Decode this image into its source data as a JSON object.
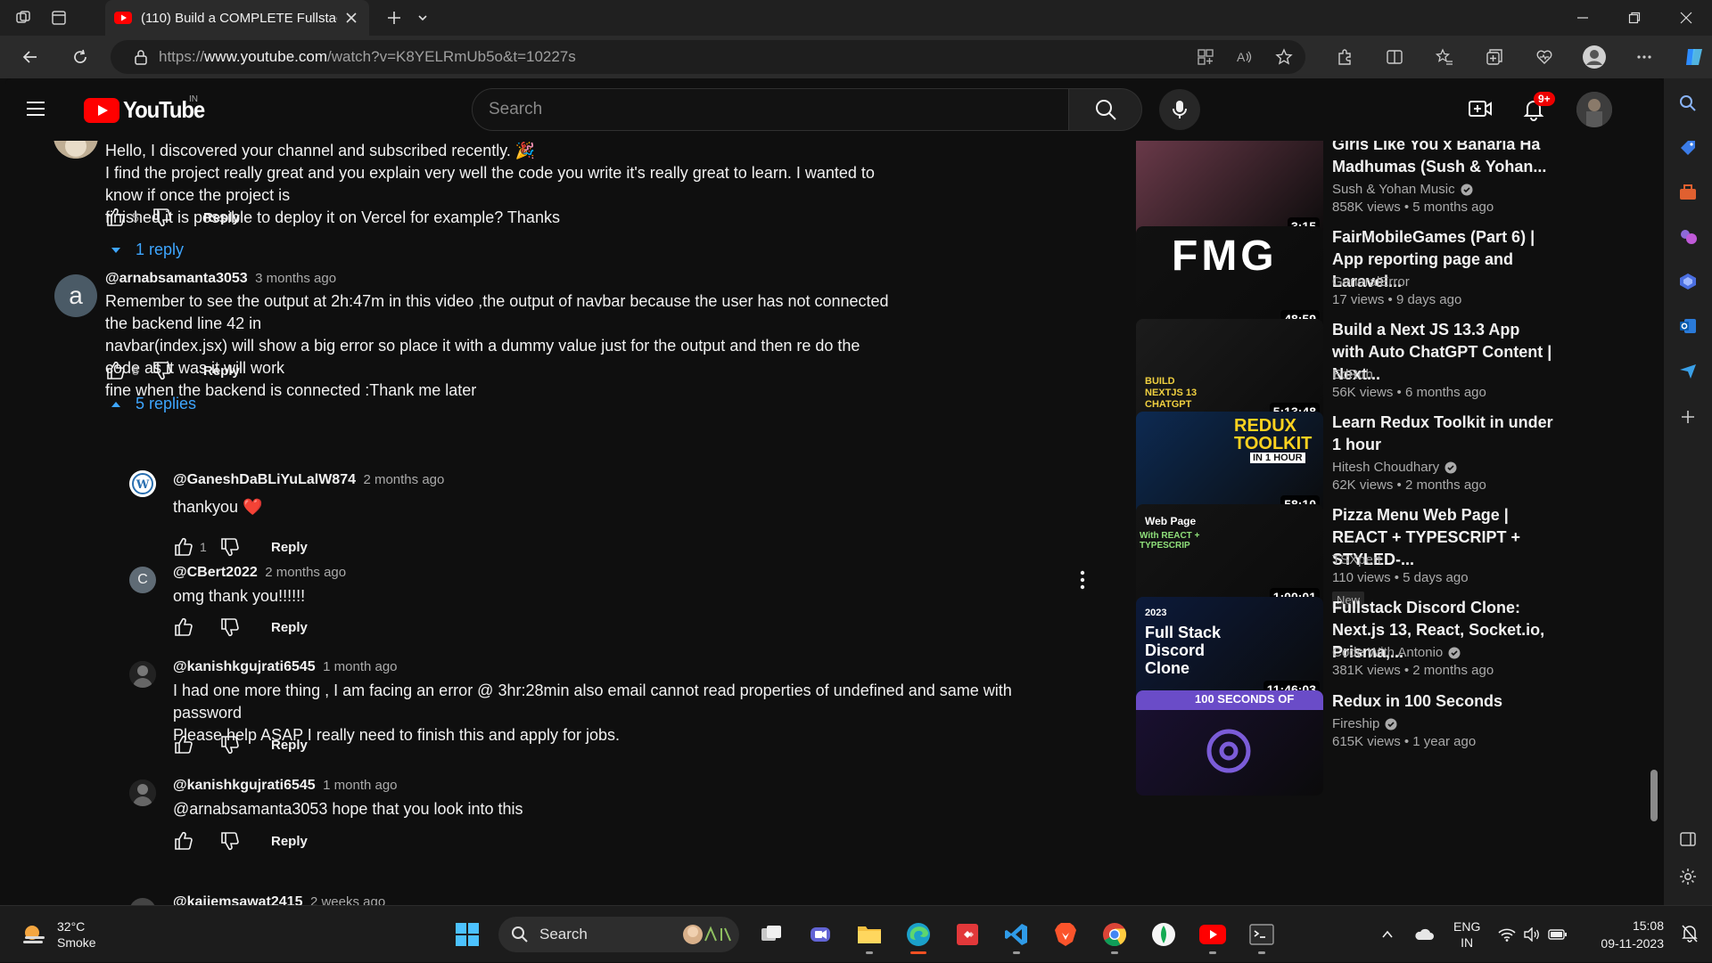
{
  "browser": {
    "tab_title": "(110) Build a COMPLETE Fullstack",
    "url_prefix": "https://",
    "url_domain": "www.youtube.com",
    "url_path": "/watch?v=K8YELRmUb5o&t=10227s"
  },
  "youtube": {
    "logo_text": "YouTube",
    "country": "IN",
    "search_placeholder": "Search",
    "notif_badge": "9+"
  },
  "comments": [
    {
      "handle": "",
      "ago": "",
      "lines": [
        "Hello, I discovered your channel and subscribed recently. 🎉",
        "I find the project really great and you explain very well the code you write it's really great to learn. I wanted to know if once the project is",
        "finished it is possible to deploy it on Vercel for example? Thanks"
      ],
      "likes": "5",
      "reply_label": "Reply",
      "replies_toggle": "1 reply"
    },
    {
      "handle": "@arnabsamanta3053",
      "ago": "3 months ago",
      "avatar_letter": "a",
      "lines": [
        "Remember to see the output at 2h:47m in this video ,the output of navbar because the user has not connected the backend line 42 in",
        "navbar(index.jsx) will show a big error so place it with a dummy value just for the output and then re do the code as it was it will work",
        "fine when the backend is connected :Thank me later"
      ],
      "likes": "8",
      "reply_label": "Reply",
      "replies_toggle": "5 replies"
    }
  ],
  "replies": [
    {
      "handle": "@GaneshDaBLiYuLalW874",
      "ago": "2 months ago",
      "text": "thankyou ❤️",
      "likes": "1",
      "reply_label": "Reply"
    },
    {
      "handle": "@CBert2022",
      "ago": "2 months ago",
      "avatar_letter": "C",
      "text": "omg thank you!!!!!!",
      "likes": "",
      "reply_label": "Reply"
    },
    {
      "handle": "@kanishkgujrati6545",
      "ago": "1 month ago",
      "lines": [
        "I had one more thing , I am facing an error @ 3hr:28min also email cannot read properties of undefined and same with password",
        "Please help ASAP I really need to finish this and apply for jobs."
      ],
      "likes": "",
      "reply_label": "Reply"
    },
    {
      "handle": "@kanishkgujrati6545",
      "ago": "1 month ago",
      "text": "@arnabsamanta3053 hope that you look into this",
      "likes": "",
      "reply_label": "Reply"
    },
    {
      "handle": "@kajjemsawat2415",
      "ago": "2 weeks ago"
    }
  ],
  "related": [
    {
      "title": "Girls Like You x Baharla Ha Madhumas (Sush & Yohan...",
      "channel": "Sush & Yohan Music",
      "verified": true,
      "meta": "858K views  •  5 months ago",
      "duration": "3:15",
      "thumb_color": "#6b3a4a"
    },
    {
      "title": "FairMobileGames (Part 6) | App reporting page and Laravel...",
      "channel": "GeneralError",
      "verified": false,
      "meta": "17 views  •  9 days ago",
      "duration": "48:59",
      "thumb_color": "#111111",
      "thumb_text": "FMG"
    },
    {
      "title": "Build a Next JS 13.3 App with Auto ChatGPT Content | Next...",
      "channel": "EdRoh",
      "verified": false,
      "meta": "56K views  •  6 months ago",
      "duration": "5:13:48",
      "thumb_color": "#1c1c1c",
      "thumb_text": "BUILD NEXTJS 13 CHATGPT APP",
      "progress": 1.0
    },
    {
      "title": "Learn Redux Toolkit in under 1 hour",
      "channel": "Hitesh Choudhary",
      "verified": true,
      "meta": "62K views  •  2 months ago",
      "duration": "58:10",
      "thumb_color": "#0d2a52",
      "thumb_text": "REDUX TOOLKIT",
      "thumb_sub": "IN 1 HOUR"
    },
    {
      "title": "Pizza Menu Web Page | REACT + TYPESCRIPT + STYLED-...",
      "channel": "TSXpert",
      "verified": false,
      "meta": "110 views  •  5 days ago",
      "duration": "1:00:01",
      "thumb_color": "#141414",
      "thumb_text": "Web Page",
      "thumb_sub": "With REACT + TYPESCRIP",
      "badge": "New"
    },
    {
      "title": "Fullstack Discord Clone: Next.js 13, React, Socket.io, Prisma,...",
      "channel": "Code With Antonio",
      "verified": true,
      "meta": "381K views  •  2 months ago",
      "duration": "11:46:03",
      "thumb_color": "#0c1a3a",
      "thumb_text": "Full Stack Discord Clone",
      "thumb_sub": "2023"
    },
    {
      "title": "Redux in 100 Seconds",
      "channel": "Fireship",
      "verified": true,
      "meta": "615K views  •  1 year ago",
      "duration": "",
      "thumb_color": "#1a1033",
      "thumb_text": "100 SECONDS OF"
    }
  ],
  "taskbar": {
    "temp": "32°C",
    "weather": "Smoke",
    "search_label": "Search",
    "lang": "ENG",
    "region": "IN",
    "time": "15:08",
    "date": "09-11-2023"
  },
  "colors": {
    "accent_link": "#3ea6ff",
    "youtube_red": "#ff0000"
  }
}
